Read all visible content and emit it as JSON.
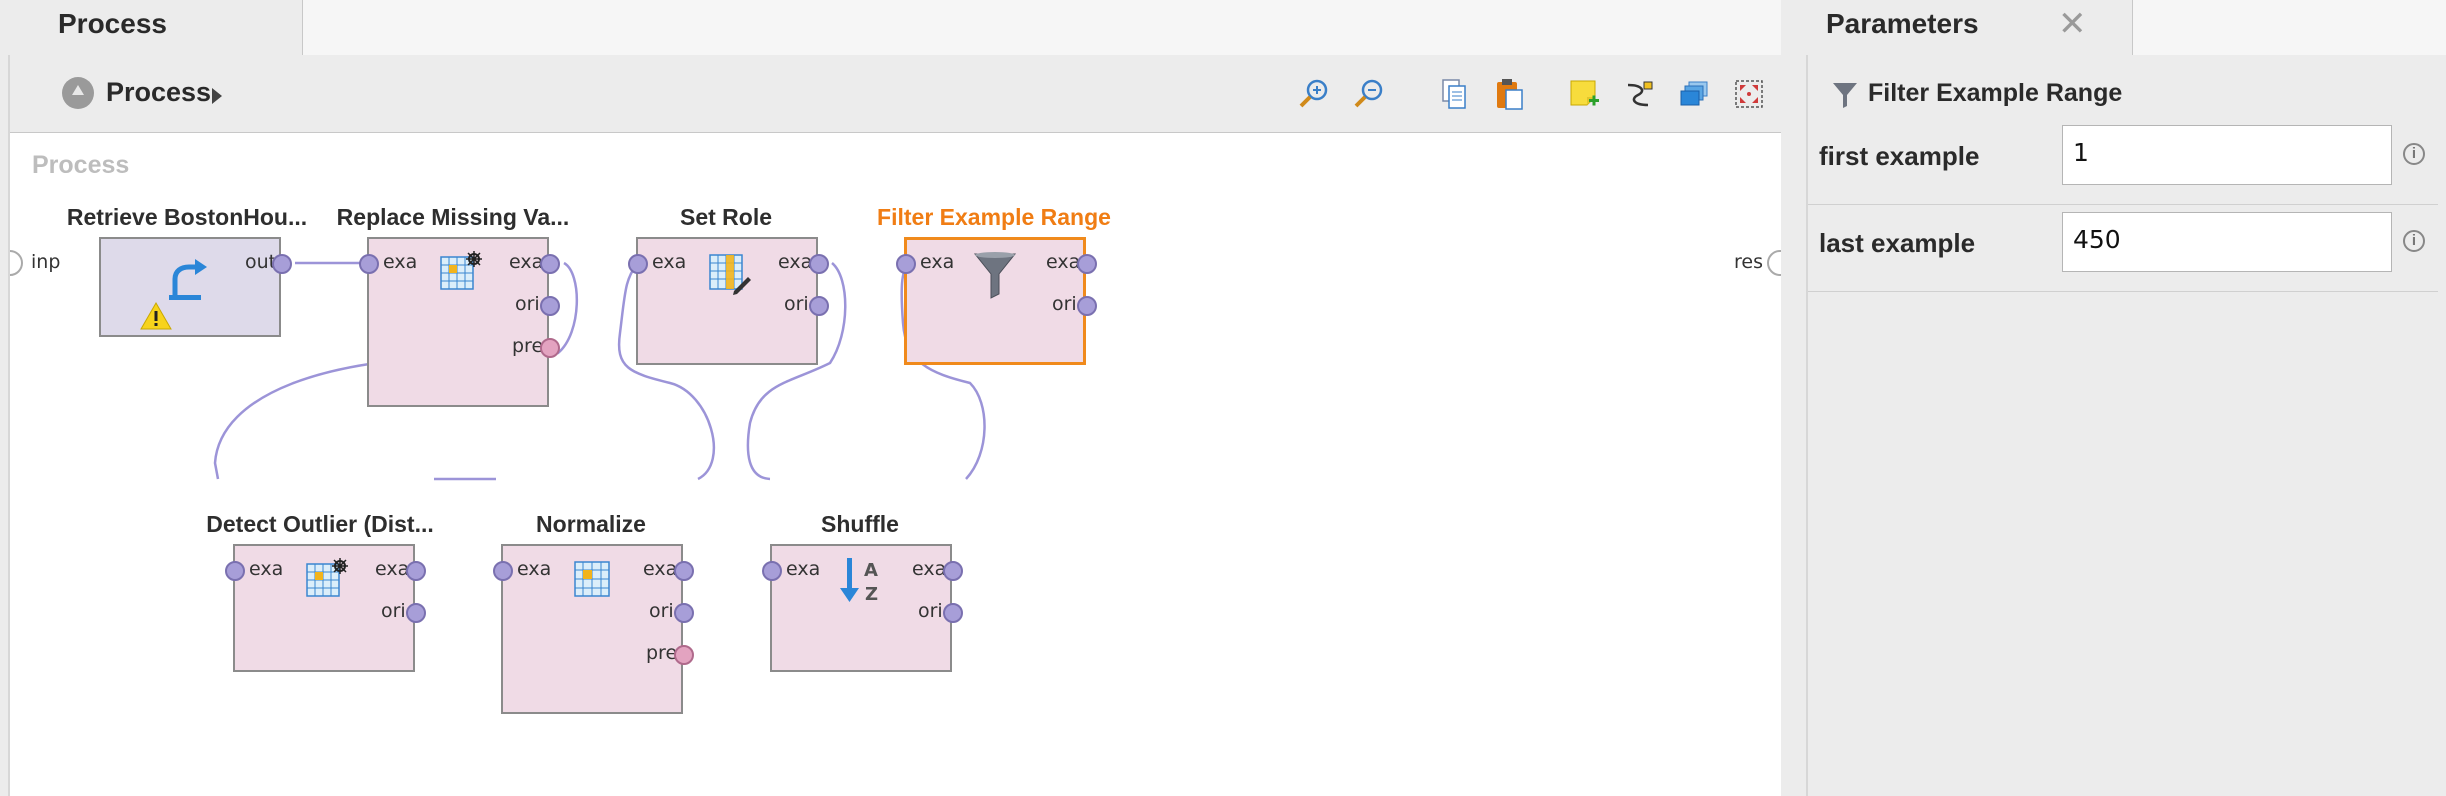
{
  "process_panel": {
    "tab_title": "Process",
    "breadcrumb": "Process",
    "canvas_title": "Process",
    "toolbar": {
      "icons": [
        "zoom-in-icon",
        "zoom-out-icon",
        "copy-icon",
        "paste-icon",
        "add-note-icon",
        "auto-wire-icon",
        "arrange-layers-icon",
        "fit-to-view-icon"
      ]
    },
    "left_edge_port": "inp",
    "right_edge_port": "res",
    "operators": {
      "retrieve": {
        "title": "Retrieve BostonHou...",
        "ports_out": [
          "out"
        ]
      },
      "replace_missing": {
        "title": "Replace Missing Va...",
        "ports_in": [
          "exa"
        ],
        "ports_out": [
          "exa",
          "ori",
          "pre"
        ]
      },
      "set_role": {
        "title": "Set Role",
        "ports_in": [
          "exa"
        ],
        "ports_out": [
          "exa",
          "ori"
        ]
      },
      "filter_range": {
        "title": "Filter Example Range",
        "ports_in": [
          "exa"
        ],
        "ports_out": [
          "exa",
          "ori"
        ]
      },
      "detect_outlier": {
        "title": "Detect Outlier (Dist...",
        "ports_in": [
          "exa"
        ],
        "ports_out": [
          "exa",
          "ori"
        ]
      },
      "normalize": {
        "title": "Normalize",
        "ports_in": [
          "exa"
        ],
        "ports_out": [
          "exa",
          "ori",
          "pre"
        ]
      },
      "shuffle": {
        "title": "Shuffle",
        "ports_in": [
          "exa"
        ],
        "ports_out": [
          "exa",
          "ori"
        ]
      }
    },
    "colors": {
      "selected": "#f07d14",
      "operator_fill": "#f0dbe6",
      "retrieve_fill": "#dedaea",
      "port": "#a79ed8",
      "wire": "#9c94d8"
    }
  },
  "parameters_panel": {
    "tab_title": "Parameters",
    "close_glyph": "✕",
    "operator_name": "Filter Example Range",
    "params": [
      {
        "label": "first example",
        "value": "1"
      },
      {
        "label": "last example",
        "value": "450"
      }
    ]
  }
}
